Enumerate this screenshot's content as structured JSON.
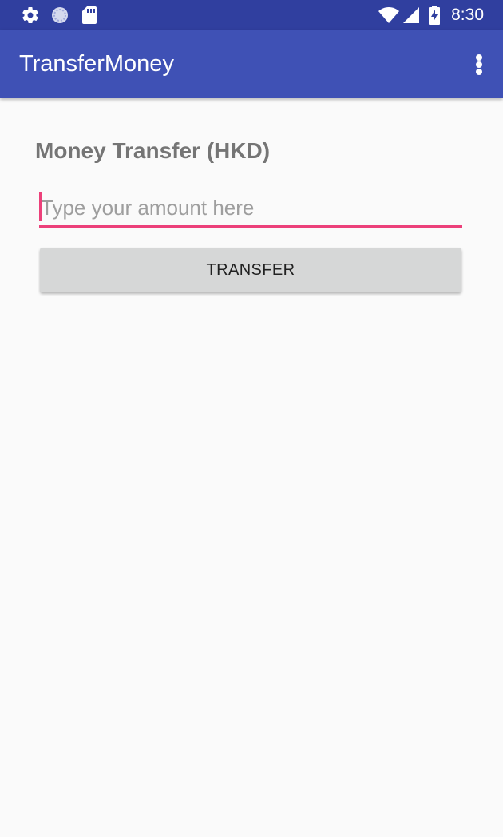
{
  "status_bar": {
    "time": "8:30",
    "icons": [
      "gear-icon",
      "sync-circle-icon",
      "sd-card-icon",
      "wifi-icon",
      "signal-icon",
      "battery-charging-icon"
    ],
    "background": "#303f9f"
  },
  "app_bar": {
    "title": "TransferMoney",
    "overflow_icon": "more-vert-icon",
    "background": "#3f51b5"
  },
  "main": {
    "heading": "Money Transfer (HKD)",
    "amount_input": {
      "value": "",
      "placeholder": "Type your amount here"
    },
    "transfer_button_label": "TRANSFER"
  },
  "colors": {
    "accent": "#ec407a",
    "heading_text": "#757575",
    "button_background": "#d6d7d7",
    "page_background": "#fafafa"
  }
}
